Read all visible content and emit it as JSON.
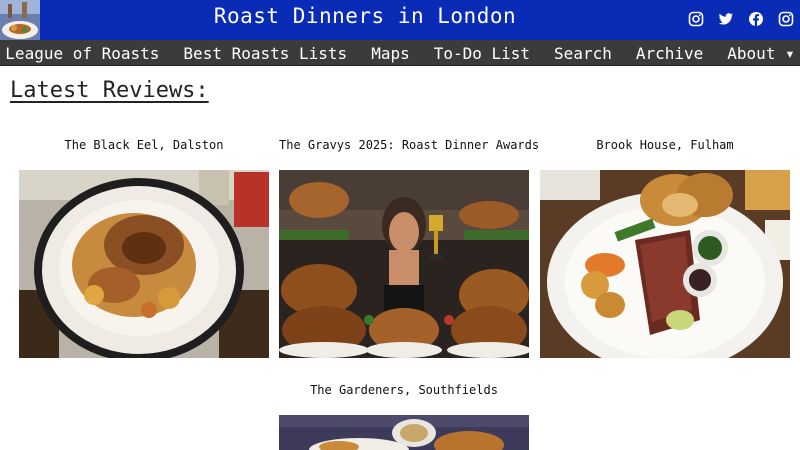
{
  "header": {
    "title": "Roast Dinners in London",
    "social": [
      {
        "icon": "instagram-icon"
      },
      {
        "icon": "twitter-icon"
      },
      {
        "icon": "facebook-icon"
      },
      {
        "icon": "instagram-icon"
      }
    ]
  },
  "nav": {
    "items": [
      {
        "label": "League of Roasts"
      },
      {
        "label": "Best Roasts Lists"
      },
      {
        "label": "Maps"
      },
      {
        "label": "To-Do List"
      },
      {
        "label": "Search"
      },
      {
        "label": "Archive"
      },
      {
        "label": "About ▾"
      }
    ]
  },
  "main": {
    "section_title": "Latest Reviews:",
    "reviews": [
      {
        "title": "The Black Eel, Dalston"
      },
      {
        "title": "The Gravys 2025: Roast Dinner Awards"
      },
      {
        "title": "Brook House, Fulham"
      },
      {
        "title": "The Gardeners, Southfields"
      }
    ]
  },
  "colors": {
    "header_bg": "#0a2bb5",
    "nav_bg": "#3b3b3b"
  }
}
